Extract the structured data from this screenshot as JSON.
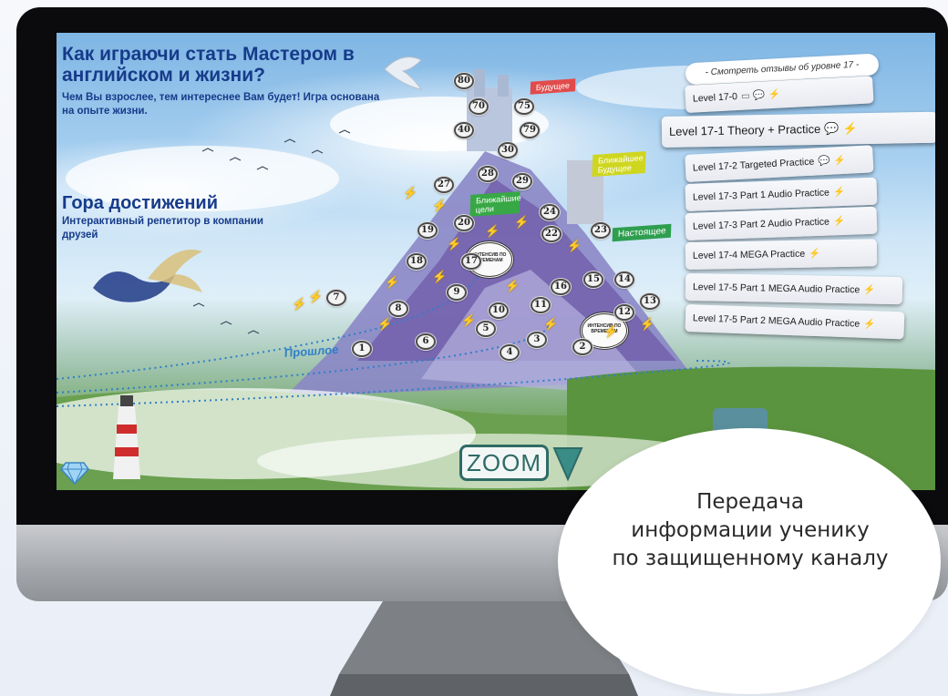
{
  "colors": {
    "headline": "#163b8a",
    "bolt": "#f5c400",
    "zoom": "#2f6b66",
    "bezel": "#0b0b0d"
  },
  "game": {
    "headline": "Как играючи стать Мастером в английском и жизни?",
    "subline": "Чем Вы взрослее, тем интереснее Вам будет! Игра основана на опыте жизни.",
    "section_title": "Гора достижений",
    "section_sub": "Интерактивный репетитор в компании друзей",
    "flags": {
      "future": "Будущее",
      "near_future": "Ближайшее Будущее",
      "near_goals": "Ближайшие цели",
      "present": "Настоящее",
      "past": "Прошлое"
    },
    "medallion_text": "ИНТЕНСИВ ПО ВРЕМЕНАМ",
    "nodes": [
      "1",
      "2",
      "3",
      "4",
      "5",
      "6",
      "7",
      "8",
      "9",
      "10",
      "11",
      "12",
      "13",
      "14",
      "15",
      "16",
      "17",
      "18",
      "19",
      "20",
      "22",
      "23",
      "24",
      "27",
      "28",
      "29",
      "30",
      "40",
      "70",
      "75",
      "79",
      "80"
    ],
    "zoom_label": "ZOOM"
  },
  "levels_menu": {
    "reviews": "- Смотреть отзывы об уровне 17 -",
    "items": [
      "Level 17-0",
      "Level 17-1 Theory + Practice",
      "Level 17-2 Targeted Practice",
      "Level 17-3 Part 1 Audio Practice",
      "Level 17-3 Part 2 Audio Practice",
      "Level 17-4 MEGA Practice",
      "Level 17-5 Part 1 MEGA Audio Practice",
      "Level 17-5 Part 2 MEGA Audio Practice"
    ]
  },
  "bubble": {
    "line1": "Передача",
    "line2": "информации ученику",
    "line3": "по защищенному каналу"
  },
  "icons": [
    "lightning-icon",
    "comment-icon",
    "diamond-icon",
    "down-arrow-icon",
    "lighthouse-icon"
  ]
}
